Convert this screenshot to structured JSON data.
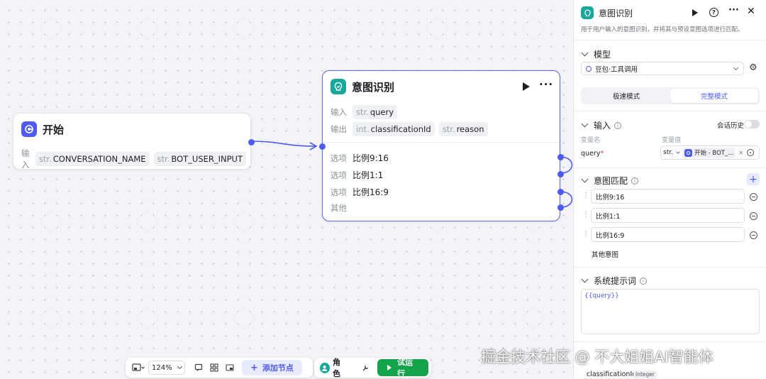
{
  "canvas": {
    "start_node": {
      "title": "开始",
      "input_label": "输入",
      "inputs": [
        {
          "type": "str.",
          "name": "CONVERSATION_NAME"
        },
        {
          "type": "str.",
          "name": "BOT_USER_INPUT"
        }
      ]
    },
    "intent_node": {
      "title": "意图识别",
      "input_label": "输入",
      "output_label": "输出",
      "input": {
        "type": "str.",
        "name": "query"
      },
      "outputs": [
        {
          "type": "int.",
          "name": "classificationId"
        },
        {
          "type": "str.",
          "name": "reason"
        }
      ],
      "option_label": "选项",
      "options": [
        "比例9:16",
        "比例1:1",
        "比例16:9"
      ],
      "other_label": "其他",
      "run_icon": "play-icon",
      "more_icon": "more-icon"
    },
    "toolbar": {
      "zoom": "124%",
      "add_node": "添加节点",
      "role": "角色",
      "test_run": "试运行"
    }
  },
  "panel": {
    "title": "意图识别",
    "description": "用于用户输入的意图识别，并将其与预设意图选项进行匹配。",
    "model": {
      "section": "模型",
      "selected": "豆包·工具调用",
      "modes": [
        "极速模式",
        "完整模式"
      ],
      "active_mode": "完整模式"
    },
    "input": {
      "section": "输入",
      "history_label": "会话历史",
      "col_name": "变量名",
      "col_value": "变量值",
      "var_name": "query",
      "var_type": "str.",
      "var_ref": "开始 - BOT_..."
    },
    "intents": {
      "section": "意图匹配",
      "items": [
        "比例9:16",
        "比例1:1",
        "比例16:9"
      ],
      "other": "其他意图"
    },
    "system_prompt": {
      "section": "系统提示词",
      "value": "{{query}}"
    },
    "output": {
      "name": "classificationId",
      "type": "Integer"
    }
  },
  "watermark": "掘金技术社区 @ 不大姐姐AI智能体",
  "colors": {
    "accent": "#4e5bf0",
    "teal": "#17a79b",
    "run": "#13a44b"
  }
}
